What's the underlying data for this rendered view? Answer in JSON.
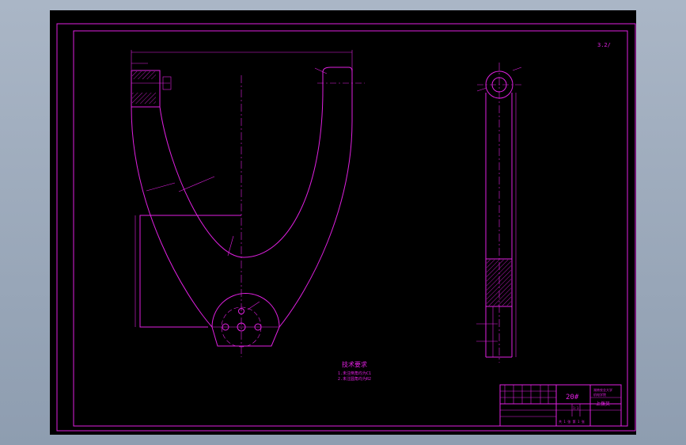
{
  "drawing": {
    "roughness_symbol": "3.2/",
    "material_label": "20#",
    "part_name": "上拨叉",
    "tech_requirements_title": "技术要求",
    "tech_requirements": [
      "1.未注倒角均为C1",
      "2.未注圆角均为R2"
    ],
    "block_small_text_1": "湖南农业大学",
    "block_small_text_2": "机电学院",
    "scale_ratio": "1:1",
    "sheet_info": "共 1 张 第 1 张"
  },
  "colors": {
    "sheet_bg": "#000000",
    "line": "#e020e0",
    "window_bg": "#9aa8ba"
  }
}
